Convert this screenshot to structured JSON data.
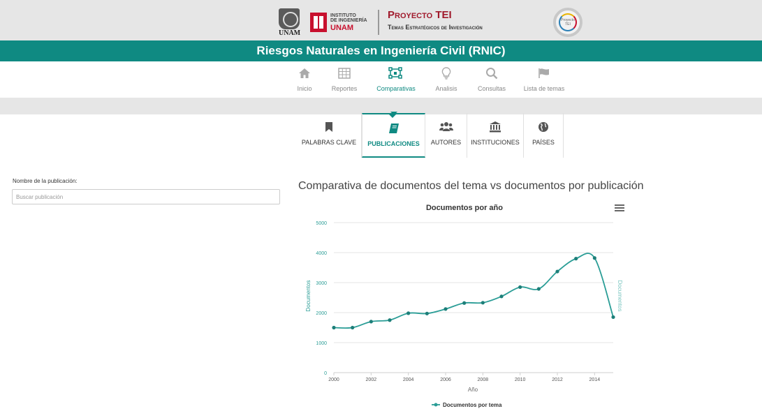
{
  "header": {
    "unam_label": "UNAM",
    "ii_line1": "INSTITUTO",
    "ii_line2": "DE INGENIERÍA",
    "ii_line3": "UNAM",
    "project_title": "Proyecto TEI",
    "project_subtitle": "Temas Estratégicos de Investigación",
    "badge_label": "Proyecto TEI"
  },
  "title": "Riesgos Naturales en Ingeniería Civil (RNIC)",
  "main_nav": {
    "items": [
      {
        "label": "Inicio",
        "icon": "home-icon"
      },
      {
        "label": "Reportes",
        "icon": "grid-icon"
      },
      {
        "label": "Comparativas",
        "icon": "compare-icon",
        "active": true
      },
      {
        "label": "Analisis",
        "icon": "lightbulb-icon"
      },
      {
        "label": "Consultas",
        "icon": "search-icon"
      },
      {
        "label": "Lista de temas",
        "icon": "flag-icon"
      }
    ]
  },
  "sub_tabs": {
    "items": [
      {
        "label": "PALABRAS CLAVE",
        "icon": "bookmark-icon"
      },
      {
        "label": "PUBLICACIONES",
        "icon": "book-icon",
        "active": true
      },
      {
        "label": "AUTORES",
        "icon": "users-icon"
      },
      {
        "label": "INSTITUCIONES",
        "icon": "institution-icon"
      },
      {
        "label": "PAÍSES",
        "icon": "globe-icon"
      }
    ]
  },
  "filter": {
    "label": "Nombre de la publicación:",
    "placeholder": "Buscar publicación"
  },
  "chart_heading": "Comparativa de documentos del tema vs documentos por publicación",
  "colors": {
    "accent": "#0f8a82",
    "series": "#2a9d96",
    "brand_red": "#c8102e"
  },
  "chart_data": {
    "type": "line",
    "title": "Documentos por año",
    "xlabel": "Año",
    "ylabel": "Documentos",
    "ylabel_right": "Documentos",
    "x_ticks": [
      "2000",
      "2002",
      "2004",
      "2006",
      "2008",
      "2010",
      "2012",
      "2014"
    ],
    "y_ticks": [
      "0",
      "1000",
      "2000",
      "3000",
      "4000",
      "5000"
    ],
    "xlim": [
      2000,
      2015
    ],
    "ylim": [
      0,
      5000
    ],
    "grid": true,
    "legend_position": "bottom-center",
    "series": [
      {
        "name": "Documentos por tema",
        "x": [
          2000,
          2001,
          2002,
          2003,
          2004,
          2005,
          2006,
          2007,
          2008,
          2009,
          2010,
          2011,
          2012,
          2013,
          2014,
          2015
        ],
        "values": [
          1500,
          1500,
          1700,
          1750,
          1980,
          1970,
          2120,
          2320,
          2330,
          2540,
          2850,
          2790,
          3370,
          3800,
          3820,
          1850
        ]
      }
    ]
  }
}
